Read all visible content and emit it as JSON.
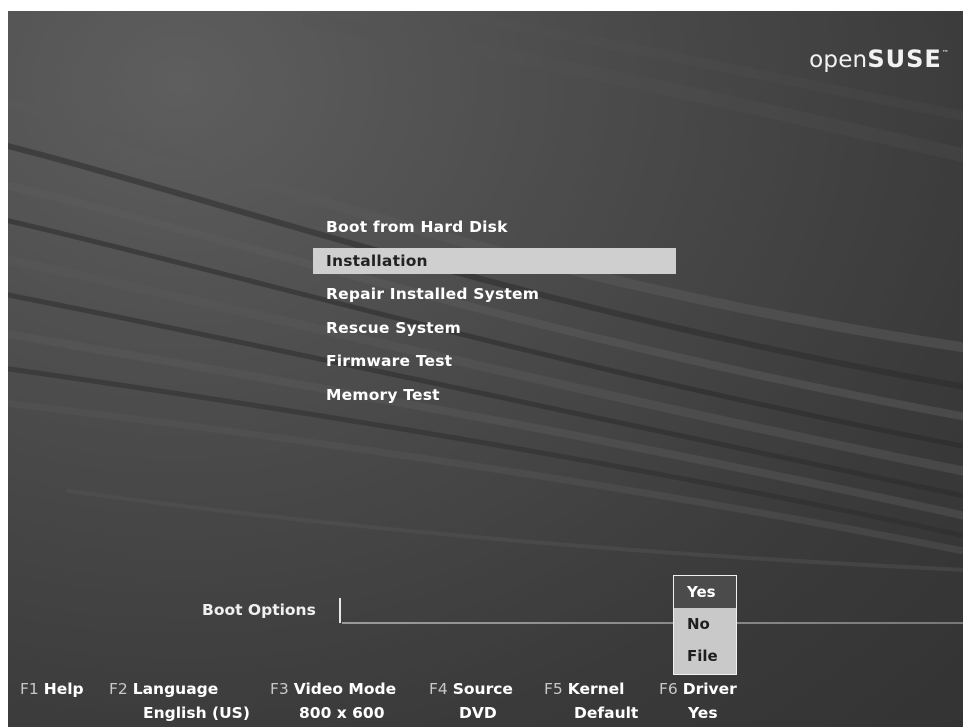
{
  "logo": {
    "light": "open",
    "bold": "SUSE",
    "tm": "™"
  },
  "menu": {
    "items": [
      {
        "label": "Boot from Hard Disk",
        "selected": false
      },
      {
        "label": "Installation",
        "selected": true
      },
      {
        "label": "Repair Installed System",
        "selected": false
      },
      {
        "label": "Rescue System",
        "selected": false
      },
      {
        "label": "Firmware Test",
        "selected": false
      },
      {
        "label": "Memory Test",
        "selected": false
      }
    ]
  },
  "boot_options": {
    "label": "Boot Options",
    "value": ""
  },
  "driver_dropdown": {
    "options": [
      "Yes",
      "No",
      "File"
    ],
    "selected": "Yes"
  },
  "function_keys": [
    {
      "key": "F1",
      "name": "Help",
      "value": ""
    },
    {
      "key": "F2",
      "name": "Language",
      "value": "English (US)"
    },
    {
      "key": "F3",
      "name": "Video Mode",
      "value": "800 x 600"
    },
    {
      "key": "F4",
      "name": "Source",
      "value": "DVD"
    },
    {
      "key": "F5",
      "name": "Kernel",
      "value": "Default"
    },
    {
      "key": "F6",
      "name": "Driver",
      "value": "Yes"
    }
  ],
  "colors": {
    "background": "#444444",
    "selection_bar": "#cfcfcf",
    "text": "#ffffff",
    "dropdown_bg": "#c9c9c9",
    "dropdown_selected": "#4b4b4b"
  }
}
